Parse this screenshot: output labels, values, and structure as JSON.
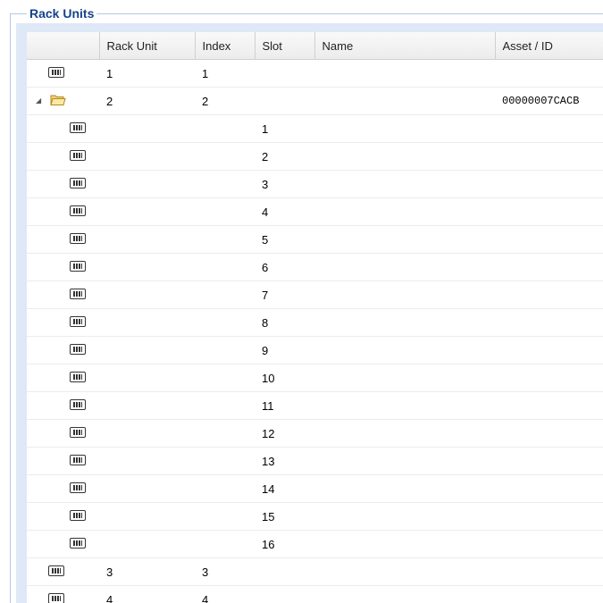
{
  "panel": {
    "title": "Rack Units"
  },
  "columns": [
    "",
    "Rack Unit",
    "Index",
    "Slot",
    "Name",
    "Asset / ID"
  ],
  "rows": [
    {
      "level": 0,
      "icon": "module-icon",
      "rack_unit": "1",
      "index": "1",
      "slot": "",
      "name": "",
      "asset": ""
    },
    {
      "level": 0,
      "icon": "folder-icon",
      "expanded": true,
      "rack_unit": "2",
      "index": "2",
      "slot": "",
      "name": "",
      "asset": "00000007CACB"
    },
    {
      "level": 1,
      "icon": "module-icon",
      "rack_unit": "",
      "index": "",
      "slot": "1",
      "name": "",
      "asset": ""
    },
    {
      "level": 1,
      "icon": "module-icon",
      "rack_unit": "",
      "index": "",
      "slot": "2",
      "name": "",
      "asset": ""
    },
    {
      "level": 1,
      "icon": "module-icon",
      "rack_unit": "",
      "index": "",
      "slot": "3",
      "name": "",
      "asset": ""
    },
    {
      "level": 1,
      "icon": "module-icon",
      "rack_unit": "",
      "index": "",
      "slot": "4",
      "name": "",
      "asset": ""
    },
    {
      "level": 1,
      "icon": "module-icon",
      "rack_unit": "",
      "index": "",
      "slot": "5",
      "name": "",
      "asset": ""
    },
    {
      "level": 1,
      "icon": "module-icon",
      "rack_unit": "",
      "index": "",
      "slot": "6",
      "name": "",
      "asset": ""
    },
    {
      "level": 1,
      "icon": "module-icon",
      "rack_unit": "",
      "index": "",
      "slot": "7",
      "name": "",
      "asset": ""
    },
    {
      "level": 1,
      "icon": "module-icon",
      "rack_unit": "",
      "index": "",
      "slot": "8",
      "name": "",
      "asset": ""
    },
    {
      "level": 1,
      "icon": "module-icon",
      "rack_unit": "",
      "index": "",
      "slot": "9",
      "name": "",
      "asset": ""
    },
    {
      "level": 1,
      "icon": "module-icon",
      "rack_unit": "",
      "index": "",
      "slot": "10",
      "name": "",
      "asset": ""
    },
    {
      "level": 1,
      "icon": "module-icon",
      "rack_unit": "",
      "index": "",
      "slot": "11",
      "name": "",
      "asset": ""
    },
    {
      "level": 1,
      "icon": "module-icon",
      "rack_unit": "",
      "index": "",
      "slot": "12",
      "name": "",
      "asset": ""
    },
    {
      "level": 1,
      "icon": "module-icon",
      "rack_unit": "",
      "index": "",
      "slot": "13",
      "name": "",
      "asset": ""
    },
    {
      "level": 1,
      "icon": "module-icon",
      "rack_unit": "",
      "index": "",
      "slot": "14",
      "name": "",
      "asset": ""
    },
    {
      "level": 1,
      "icon": "module-icon",
      "rack_unit": "",
      "index": "",
      "slot": "15",
      "name": "",
      "asset": ""
    },
    {
      "level": 1,
      "icon": "module-icon",
      "rack_unit": "",
      "index": "",
      "slot": "16",
      "name": "",
      "asset": ""
    },
    {
      "level": 0,
      "icon": "module-icon",
      "rack_unit": "3",
      "index": "3",
      "slot": "",
      "name": "",
      "asset": ""
    },
    {
      "level": 0,
      "icon": "module-icon",
      "rack_unit": "4",
      "index": "4",
      "slot": "",
      "name": "",
      "asset": ""
    }
  ]
}
